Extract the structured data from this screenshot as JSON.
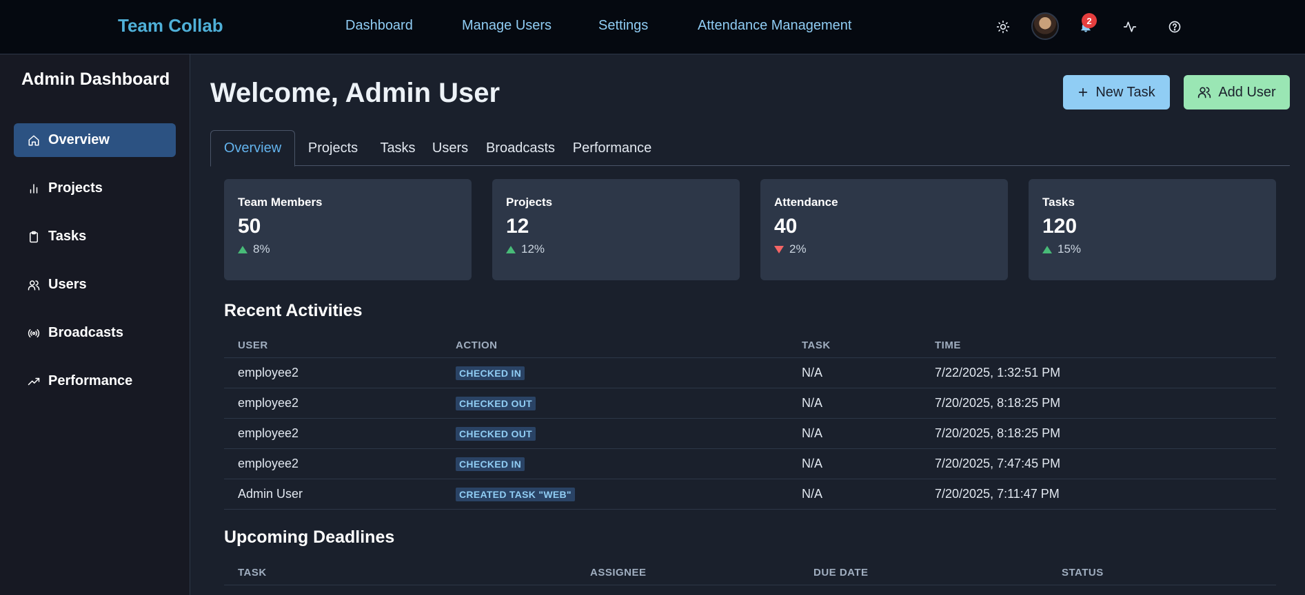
{
  "app": {
    "brand": "Team Collab"
  },
  "topnav": {
    "links": [
      "Dashboard",
      "Manage Users",
      "Settings",
      "Attendance Management"
    ],
    "notification_count": "2"
  },
  "sidebar": {
    "title": "Admin Dashboard",
    "items": [
      {
        "label": "Overview",
        "icon": "home-icon",
        "active": true
      },
      {
        "label": "Projects",
        "icon": "bar-chart-icon"
      },
      {
        "label": "Tasks",
        "icon": "clipboard-icon"
      },
      {
        "label": "Users",
        "icon": "users-icon"
      },
      {
        "label": "Broadcasts",
        "icon": "broadcast-icon"
      },
      {
        "label": "Performance",
        "icon": "trending-up-icon"
      }
    ]
  },
  "main": {
    "welcome": "Welcome, Admin User",
    "actions": {
      "new_task": "New Task",
      "add_user": "Add User"
    },
    "tabs": [
      "Overview",
      "Projects",
      "Tasks",
      "Users",
      "Broadcasts",
      "Performance"
    ],
    "stats": [
      {
        "label": "Team Members",
        "value": "50",
        "change": "8%",
        "direction": "up"
      },
      {
        "label": "Projects",
        "value": "12",
        "change": "12%",
        "direction": "up"
      },
      {
        "label": "Attendance",
        "value": "40",
        "change": "2%",
        "direction": "down"
      },
      {
        "label": "Tasks",
        "value": "120",
        "change": "15%",
        "direction": "up"
      }
    ],
    "recent": {
      "title": "Recent Activities",
      "headers": [
        "USER",
        "ACTION",
        "TASK",
        "TIME"
      ],
      "rows": [
        {
          "user": "employee2",
          "action": "CHECKED IN",
          "task": "N/A",
          "time": "7/22/2025, 1:32:51 PM"
        },
        {
          "user": "employee2",
          "action": "CHECKED OUT",
          "task": "N/A",
          "time": "7/20/2025, 8:18:25 PM"
        },
        {
          "user": "employee2",
          "action": "CHECKED OUT",
          "task": "N/A",
          "time": "7/20/2025, 8:18:25 PM"
        },
        {
          "user": "employee2",
          "action": "CHECKED IN",
          "task": "N/A",
          "time": "7/20/2025, 7:47:45 PM"
        },
        {
          "user": "Admin User",
          "action": "CREATED TASK \"WEB\"",
          "task": "N/A",
          "time": "7/20/2025, 7:11:47 PM"
        }
      ]
    },
    "deadlines": {
      "title": "Upcoming Deadlines",
      "headers": [
        "TASK",
        "ASSIGNEE",
        "DUE DATE",
        "STATUS"
      ]
    }
  },
  "colors": {
    "brand": "#4fb0d8",
    "accent_blue": "#90cdf4",
    "accent_green": "#9ae6b4",
    "up": "#48bb78",
    "down": "#f56565",
    "badge": "#e53e3e"
  }
}
